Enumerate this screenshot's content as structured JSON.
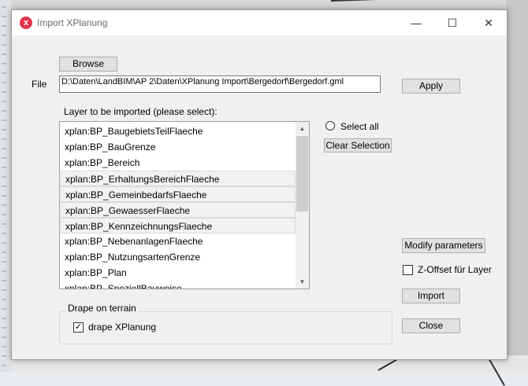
{
  "dialog": {
    "title": "Import XPlanung",
    "icon": "x-logo-icon",
    "accent": "#e2334a",
    "window_controls": {
      "minimize": "—",
      "maximize": "☐",
      "close": "✕"
    }
  },
  "browse_button": "Browse",
  "file": {
    "label": "File",
    "value": "D:\\Daten\\LandBIM\\AP 2\\Daten\\XPlanung Import\\Bergedorf\\Bergedorf.gml"
  },
  "apply_button": "Apply",
  "layers": {
    "label": "Layer to be imported (please select):",
    "items": [
      {
        "label": "xplan:BP_BaugebietsTeilFlaeche",
        "selected": false
      },
      {
        "label": "xplan:BP_BauGrenze",
        "selected": false
      },
      {
        "label": "xplan:BP_Bereich",
        "selected": false
      },
      {
        "label": "xplan:BP_ErhaltungsBereichFlaeche",
        "selected": true
      },
      {
        "label": "xplan:BP_GemeinbedarfsFlaeche",
        "selected": true
      },
      {
        "label": "xplan:BP_GewaesserFlaeche",
        "selected": true
      },
      {
        "label": "xplan:BP_KennzeichnungsFlaeche",
        "selected": true
      },
      {
        "label": "xplan:BP_NebenanlagenFlaeche",
        "selected": false
      },
      {
        "label": "xplan:BP_NutzungsartenGrenze",
        "selected": false
      },
      {
        "label": "xplan:BP_Plan",
        "selected": false
      },
      {
        "label": "xplan:BP_SpeziellBauweise",
        "selected": false
      }
    ]
  },
  "select_all": {
    "label": "Select all",
    "checked": false
  },
  "clear_selection_button": "Clear Selection",
  "modify_parameters_button": "Modify parameters",
  "z_offset": {
    "label": "Z-Offset für Layer",
    "checked": false
  },
  "import_button": "Import",
  "drape": {
    "group_label": "Drape on terrain",
    "checkbox_label": "drape XPlanung",
    "checked": true,
    "check_mark": "✓"
  },
  "close_button": "Close"
}
